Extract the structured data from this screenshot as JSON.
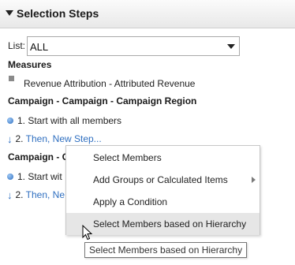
{
  "panel": {
    "title": "Selection Steps"
  },
  "list": {
    "label": "List:",
    "selected": "ALL"
  },
  "measures": {
    "heading": "Measures",
    "item": "Revenue Attribution - Attributed Revenue"
  },
  "group1": {
    "heading": "Campaign - Campaign - Campaign Region",
    "step1": "1. Start with all members",
    "step2_prefix": "2.",
    "step2_link": "Then, New Step..."
  },
  "group2": {
    "heading": "Campaign - C",
    "step1": "1. Start wit",
    "step2_prefix": "2.",
    "step2_link": "Then, Ne"
  },
  "context_menu": {
    "items": [
      {
        "label": "Select Members"
      },
      {
        "label": "Add Groups or Calculated Items"
      },
      {
        "label": "Apply a Condition"
      },
      {
        "label": "Select Members based on Hierarchy"
      }
    ]
  },
  "tooltip": {
    "text": "Select Members based on Hierarchy"
  },
  "icons": {
    "collapse": "collapse-triangle-icon",
    "dropdown": "chevron-down-icon",
    "measure_bullet": "square-bullet-icon",
    "step_start": "blue-dot-icon",
    "step_then": "down-arrow-icon",
    "submenu": "chevron-right-icon",
    "cursor": "mouse-pointer-icon"
  },
  "colors": {
    "link": "#2f6fc0",
    "menu_hover": "#e6e6e6",
    "header_bg": "#e8e8e8"
  }
}
